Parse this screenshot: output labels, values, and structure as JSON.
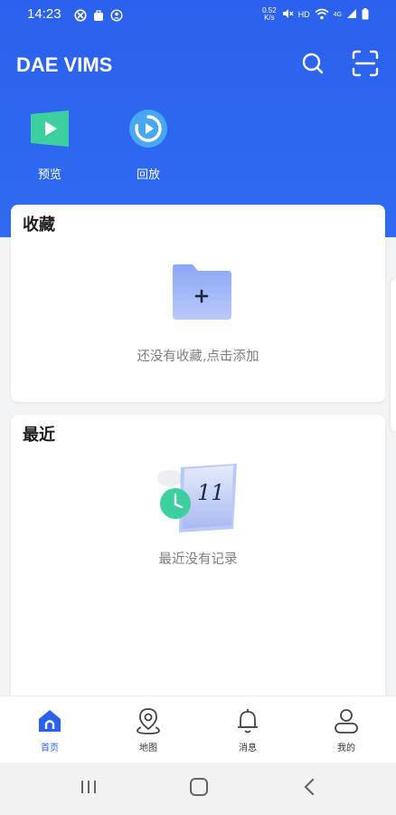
{
  "status_bar": {
    "time": "14:23",
    "left_icons": [
      "no-disturb-icon",
      "briefcase-icon",
      "account-icon"
    ],
    "net_speed_value": "0.52",
    "net_speed_unit": "K/s",
    "hd": "HD",
    "network": "4G"
  },
  "header": {
    "title": "DAE VIMS",
    "icons": [
      "search-icon",
      "scan-icon"
    ]
  },
  "quick_actions": [
    {
      "label": "预览",
      "icon": "play-icon"
    },
    {
      "label": "回放",
      "icon": "replay-icon"
    }
  ],
  "favorites": {
    "title": "收藏",
    "empty_text": "还没有收藏,点击添加",
    "icon": "add-folder-icon"
  },
  "recent": {
    "title": "最近",
    "empty_text": "最近没有记录",
    "icon": "calendar-clock-icon",
    "calendar_day": "11"
  },
  "bottom_nav": [
    {
      "label": "首页",
      "icon": "home-icon",
      "active": true
    },
    {
      "label": "地图",
      "icon": "map-pin-icon",
      "active": false
    },
    {
      "label": "消息",
      "icon": "bell-icon",
      "active": false
    },
    {
      "label": "我的",
      "icon": "user-icon",
      "active": false
    }
  ],
  "colors": {
    "primary": "#2b61ee",
    "card_bg": "#ffffff",
    "page_bg": "#f3f4f6",
    "teal": "#3ccfa0"
  }
}
